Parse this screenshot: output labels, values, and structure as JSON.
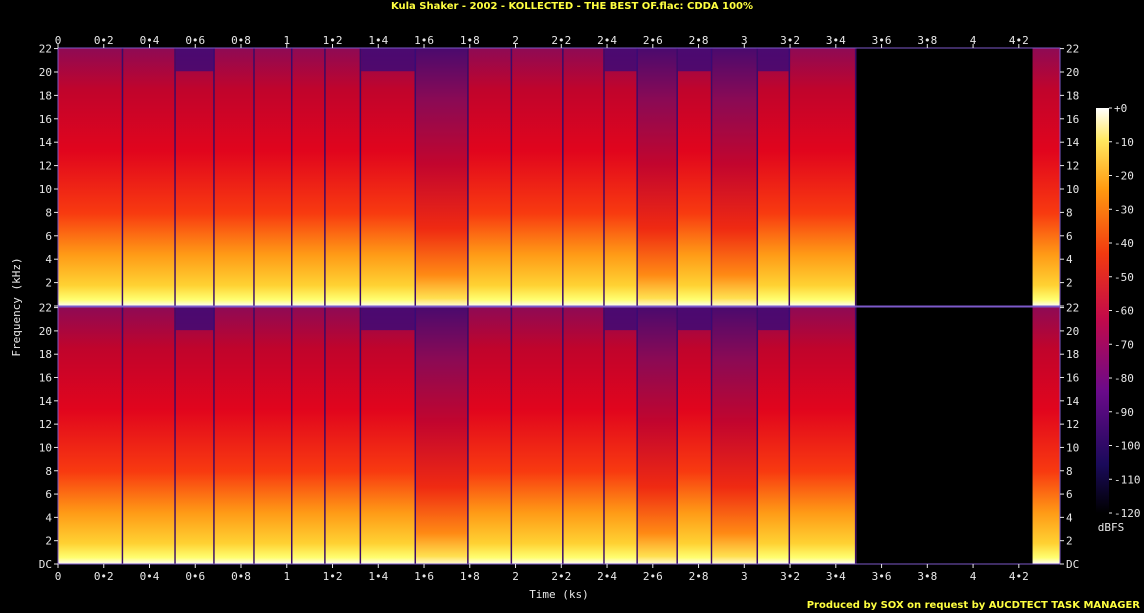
{
  "header": {
    "title": "Kula Shaker - 2002 - KOLLECTED - THE BEST OF.flac: CDDA 100%"
  },
  "footer": {
    "credit": "Produced by SOX on request by AUCDTECT TASK MANAGER"
  },
  "colors": {
    "background": "#000000",
    "text": "#e8e8e8",
    "accent": "#ffff40",
    "axis": "#7b59c9"
  },
  "chart_data": {
    "type": "heatmap",
    "title": "Kula Shaker - 2002 - KOLLECTED - THE BEST OF.flac: CDDA 100%",
    "xlabel": "Time (ks)",
    "ylabel": "Frequency (kHz)",
    "colorbar_label": "dBFS",
    "xlim": [
      0,
      4.38
    ],
    "ylim": [
      0,
      22.05
    ],
    "x_ticks": [
      "0",
      "0•2",
      "0•4",
      "0•6",
      "0•8",
      "1",
      "1•2",
      "1•4",
      "1•6",
      "1•8",
      "2",
      "2•2",
      "2•4",
      "2•6",
      "2•8",
      "3",
      "3•2",
      "3•4",
      "3•6",
      "3•8",
      "4",
      "4•2"
    ],
    "x_tick_values": [
      0,
      0.2,
      0.4,
      0.6,
      0.8,
      1.0,
      1.2,
      1.4,
      1.6,
      1.8,
      2.0,
      2.2,
      2.4,
      2.6,
      2.8,
      3.0,
      3.2,
      3.4,
      3.6,
      3.8,
      4.0,
      4.2
    ],
    "y_ticks": [
      "DC",
      "2",
      "4",
      "6",
      "8",
      "10",
      "12",
      "14",
      "16",
      "18",
      "20",
      "22"
    ],
    "y_tick_values": [
      0,
      2,
      4,
      6,
      8,
      10,
      12,
      14,
      16,
      18,
      20,
      22
    ],
    "colorbar_ticks": [
      "+0",
      "-10",
      "-20",
      "-30",
      "-40",
      "-50",
      "-60",
      "-70",
      "-80",
      "-90",
      "-100",
      "-110",
      "-120"
    ],
    "colorbar_values": [
      0,
      -10,
      -20,
      -30,
      -40,
      -50,
      -60,
      -70,
      -80,
      -90,
      -100,
      -110,
      -120
    ],
    "channels": 2,
    "track_boundaries_ks": [
      0.0,
      0.285,
      0.515,
      0.685,
      0.86,
      1.025,
      1.17,
      1.325,
      1.565,
      1.795,
      1.985,
      2.21,
      2.39,
      2.535,
      2.71,
      2.86,
      3.06,
      3.2,
      3.49
    ],
    "silence_ks": [
      3.49,
      4.26
    ],
    "tail_ks": [
      4.26,
      4.38
    ]
  }
}
